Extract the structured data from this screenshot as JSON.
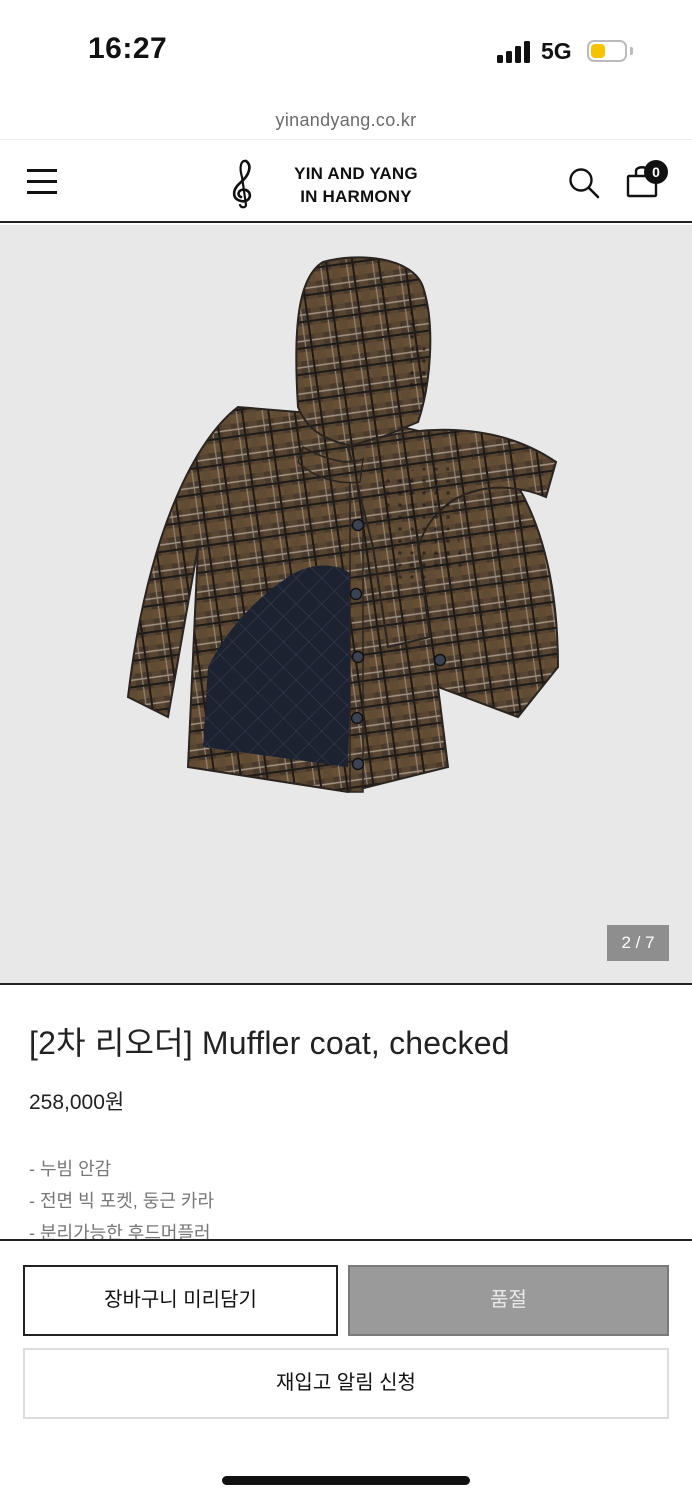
{
  "status_bar": {
    "time": "16:27",
    "network": "5G",
    "battery_color": "#f5c400"
  },
  "browser": {
    "url": "yinandyang.co.kr"
  },
  "header": {
    "brand_line1": "YIN AND YANG",
    "brand_line2": "IN HARMONY",
    "menu_icon": "hamburger-menu-icon",
    "search_icon": "search-icon",
    "cart_icon": "shopping-bag-icon",
    "cart_count": "0"
  },
  "gallery": {
    "counter": "2 / 7",
    "image": "plaid-muffler-coat-photo"
  },
  "product": {
    "title": "[2차 리오더] Muffler coat, checked",
    "price": "258,000원",
    "description": [
      "- 누빔 안감",
      "- 전면 빅 포켓, 둥근 카라",
      "- 분리가능한 후드머플러"
    ]
  },
  "actions": {
    "add_to_cart": "장바구니 미리담기",
    "sold_out": "품절",
    "restock_alert": "재입고 알림 신청"
  },
  "colors": {
    "accent": "#111111",
    "soldout_bg": "#9a9a9a",
    "gallery_bg": "#e8e8e8"
  }
}
